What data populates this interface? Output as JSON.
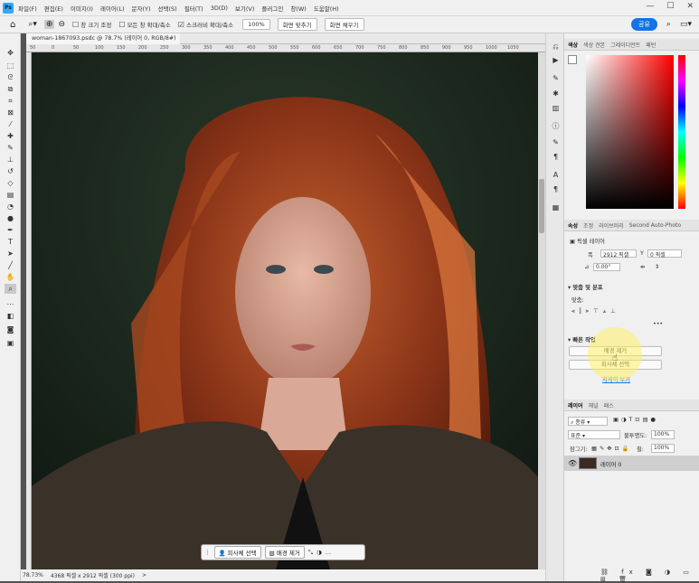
{
  "app": {
    "logo": "Ps",
    "menus": [
      "파일(F)",
      "편집(E)",
      "이미지(I)",
      "레이어(L)",
      "문자(Y)",
      "선택(S)",
      "필터(T)",
      "3D(D)",
      "보기(V)",
      "플러그인",
      "창(W)",
      "도움말(H)"
    ],
    "window_controls": [
      "minimize-icon",
      "maximize-icon",
      "close-icon"
    ]
  },
  "options": {
    "resize_window": "창 크기 조정",
    "zoom_all": "모든 창 확대/축소",
    "scrubby_zoom": "스크러비 확대/축소",
    "zoom_value": "100%",
    "fit_screen": "화면 맞추기",
    "fill_screen": "화면 채우기",
    "share": "공유"
  },
  "document": {
    "tab_title": "woman-1867093.psdc @ 78.7% (레이어 0, RGB/8#) *",
    "ruler_marks": [
      "50",
      "0",
      "50",
      "100",
      "150",
      "200",
      "250",
      "300",
      "350",
      "400",
      "450",
      "500",
      "550",
      "600",
      "650",
      "700",
      "750",
      "800",
      "850",
      "900",
      "950",
      "1000",
      "1050"
    ]
  },
  "status": {
    "zoom": "78.73%",
    "info": "4368 픽셀 x 2912 픽셀 (300 ppi)"
  },
  "context_bar": {
    "select_subject": "피사체 선택",
    "remove_bg": "배경 제거"
  },
  "color_panel": {
    "tabs": [
      "색상",
      "색상 견본",
      "그레이디언트",
      "패턴"
    ],
    "accent": "#ff0000"
  },
  "properties": {
    "tabs": [
      "속성",
      "조정",
      "라이브러리",
      "Second Auto-Photo"
    ],
    "layer_type": "픽셀 레이어",
    "w_label": "폭",
    "w_value": "2912 픽셀",
    "y_label": "Y",
    "y_value": "0 픽셀",
    "angle_value": "0.00°",
    "align_title": "맞춤 및 분포",
    "align_label": "맞춤:",
    "quick_title": "빠른 작업",
    "btn_remove_bg": "배경 제거",
    "btn_select_subject": "피사체 선택",
    "learn_more": "자세히 보기"
  },
  "layers": {
    "tabs": [
      "레이어",
      "채널",
      "패스"
    ],
    "filter": "종류",
    "blend": "표준",
    "opacity_label": "불투명도:",
    "opacity": "100%",
    "lock_label": "잠그기:",
    "fill_label": "칠:",
    "fill": "100%",
    "items": [
      {
        "name": "레이어 0"
      }
    ]
  }
}
